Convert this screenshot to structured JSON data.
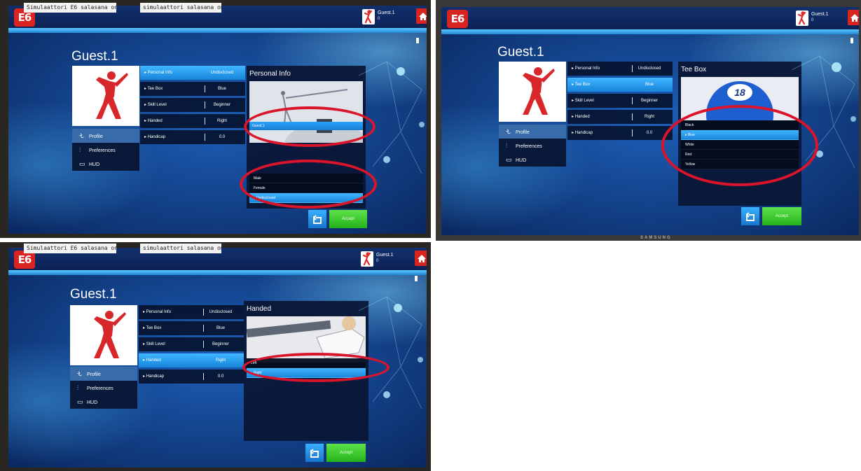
{
  "screenshots": [
    {
      "window_titles": [
        "Simulaattori E6 salasana on e6",
        "simulaattori salasana on tgc"
      ],
      "player_name": "Guest.1",
      "user_mini": {
        "name": "Guest.1",
        "sub": "0"
      },
      "menu": [
        "Profile",
        "Preferences",
        "HUD"
      ],
      "rows": [
        {
          "label": "Personal Info",
          "value": "Undisclosed"
        },
        {
          "label": "Tee Box",
          "value": "Blue"
        },
        {
          "label": "Skill Level",
          "value": "Beginner"
        },
        {
          "label": "Handed",
          "value": "Right"
        },
        {
          "label": "Handicap",
          "value": "0.0"
        }
      ],
      "panel_title": "Personal Info",
      "name_field": "Guest.1",
      "options": [
        "Male",
        "Female",
        "Undisclosed"
      ],
      "accept": "Accept"
    },
    {
      "player_name": "Guest.1",
      "user_mini": {
        "name": "Guest.1",
        "sub": "0"
      },
      "menu": [
        "Profile",
        "Preferences",
        "HUD"
      ],
      "rows": [
        {
          "label": "Personal Info",
          "value": "Undisclosed"
        },
        {
          "label": "Tee Box",
          "value": "Blue"
        },
        {
          "label": "Skill Level",
          "value": "Beginner"
        },
        {
          "label": "Handed",
          "value": "Right"
        },
        {
          "label": "Handicap",
          "value": "0.0"
        }
      ],
      "panel_title": "Tee Box",
      "ball_number": "18",
      "options": [
        "Black",
        "Blue",
        "White",
        "Red",
        "Yellow"
      ],
      "accept": "Accept",
      "bezel_brand": "SAMSUNG"
    },
    {
      "window_titles": [
        "Simulaattori E6 salasana on e6",
        "simulaattori salasana on tgc"
      ],
      "player_name": "Guest.1",
      "user_mini": {
        "name": "Guest.1",
        "sub": "0"
      },
      "menu": [
        "Profile",
        "Preferences",
        "HUD"
      ],
      "rows": [
        {
          "label": "Personal Info",
          "value": "Undisclosed"
        },
        {
          "label": "Tee Box",
          "value": "Blue"
        },
        {
          "label": "Skill Level",
          "value": "Beginner"
        },
        {
          "label": "Handed",
          "value": "Right"
        },
        {
          "label": "Handicap",
          "value": "0.0"
        }
      ],
      "panel_title": "Handed",
      "options": [
        "Left",
        "Right"
      ],
      "accept": "Accept"
    }
  ],
  "icons": {
    "logo": "e6-logo-icon",
    "home": "home-icon",
    "back": "back-arrow-icon",
    "profile": "golfer-icon",
    "preferences": "sliders-icon",
    "hud": "monitor-icon"
  },
  "colors": {
    "accent_blue": "#2aa2ff",
    "accept_green": "#3fcf2e",
    "brand_red": "#d92420",
    "annotation_red": "#d9142b"
  }
}
